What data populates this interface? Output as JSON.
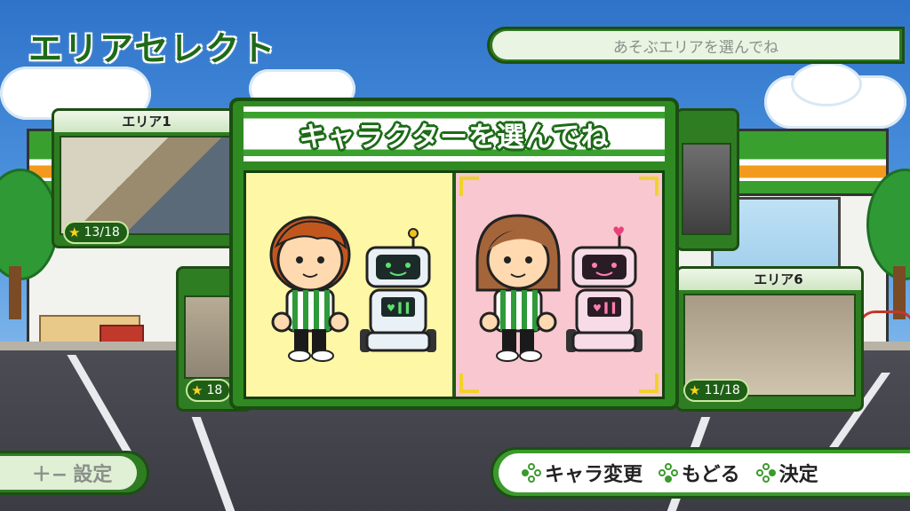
{
  "header": {
    "title": "エリアセレクト",
    "hint": "あそぶエリアを選んでね"
  },
  "areas": [
    {
      "label": "エリア1",
      "progress": "13/18"
    },
    {
      "label": "",
      "progress": "18"
    },
    {
      "label": "エリア6",
      "progress": "11/18"
    }
  ],
  "dialog": {
    "title": "キャラクターを選んでね",
    "choices": [
      {
        "name": "boy-with-robot",
        "selected": false
      },
      {
        "name": "girl-with-robot",
        "selected": true
      }
    ]
  },
  "footer": {
    "settings_label": "設定",
    "settings_icon": "plus-minus-icon",
    "controls": [
      {
        "icon": "button-left-icon",
        "label": "キャラ変更"
      },
      {
        "icon": "button-down-icon",
        "label": "もどる"
      },
      {
        "icon": "button-right-icon",
        "label": "決定"
      }
    ]
  },
  "colors": {
    "brand_green": "#2f8a22",
    "boy_bg": "#fdf7a6",
    "girl_bg": "#f9c7cf",
    "highlight": "#f1d22a"
  }
}
